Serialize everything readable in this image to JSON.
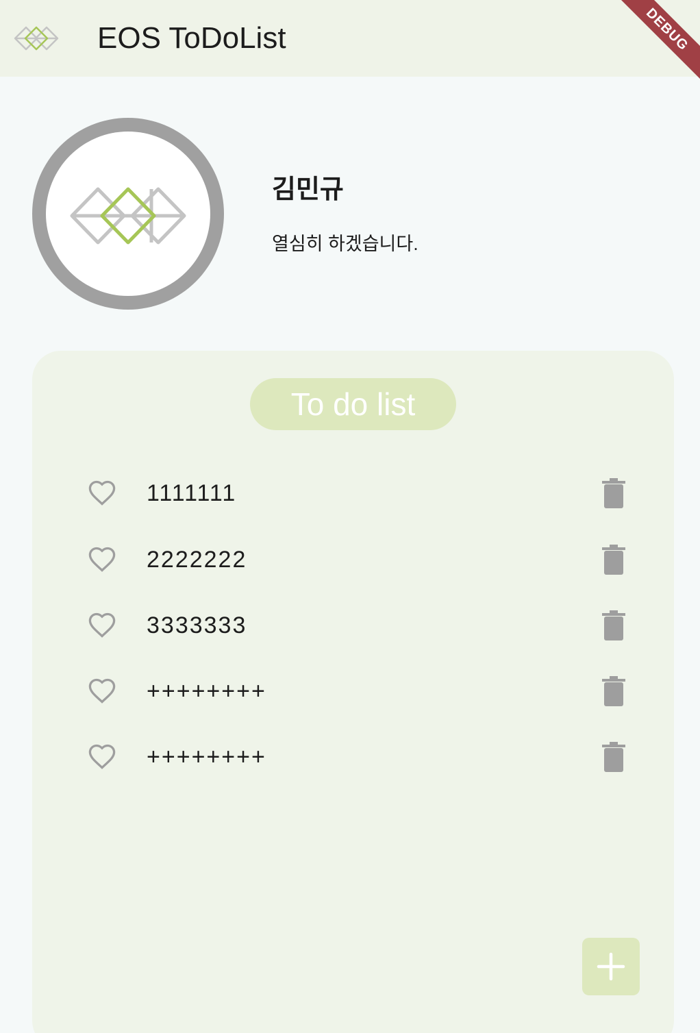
{
  "appbar": {
    "title": "EOS ToDoList",
    "debug_label": "DEBUG"
  },
  "profile": {
    "name": "김민규",
    "motto": "열심히 하겠습니다."
  },
  "todo": {
    "title": "To do list",
    "items": [
      {
        "text": "1111111",
        "liked": false
      },
      {
        "text": "2222222",
        "liked": false
      },
      {
        "text": "3333333",
        "liked": false
      },
      {
        "text": "++++++++",
        "liked": false
      },
      {
        "text": "++++++++",
        "liked": false
      }
    ]
  },
  "icons": {
    "logo": "eos-logo-icon",
    "heart": "heart-outline-icon",
    "delete": "trash-icon",
    "add": "plus-icon"
  },
  "colors": {
    "appbar_bg": "#eff3e8",
    "page_bg": "#f5f9f9",
    "card_bg": "#eff4e9",
    "accent": "#dde8bd",
    "logo_green": "#a6c657",
    "icon_gray": "#9e9e9e",
    "debug_ribbon": "#a04045"
  }
}
